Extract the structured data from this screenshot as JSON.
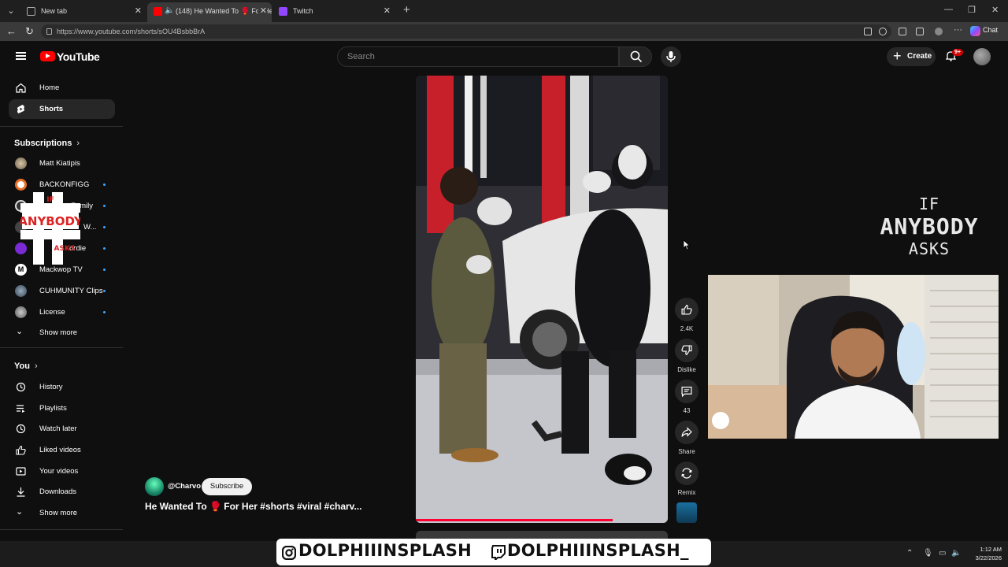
{
  "browser": {
    "tabs": [
      {
        "title": "New tab",
        "active": false
      },
      {
        "title": "(148) He Wanted To 🥊 For Her",
        "active": true
      },
      {
        "title": "Twitch",
        "active": false
      }
    ],
    "url": "https://www.youtube.com/shorts/sOU4BsbbBrA",
    "chat_label": "Chat"
  },
  "header": {
    "logo_text": "YouTube",
    "search_placeholder": "Search",
    "create_label": "Create",
    "notif_badge": "9+"
  },
  "sidebar": {
    "main": [
      {
        "label": "Home",
        "icon": "home-icon"
      },
      {
        "label": "Shorts",
        "icon": "shorts-icon",
        "active": true
      }
    ],
    "subscriptions_title": "Subscriptions",
    "subscriptions": [
      {
        "label": "Matt Kiatipis",
        "dot": false
      },
      {
        "label": "BACKONFIGG",
        "dot": true
      },
      {
        "label": "Family",
        "dot": true
      },
      {
        "label": "W...",
        "dot": true
      },
      {
        "label": "ordie",
        "dot": true
      },
      {
        "label": "Mackwop TV",
        "dot": true
      },
      {
        "label": "CUHMUNITY Clips",
        "dot": true
      },
      {
        "label": "License",
        "dot": true
      }
    ],
    "show_more_1": "Show more",
    "you_title": "You",
    "you_items": [
      {
        "label": "History",
        "icon": "history-icon"
      },
      {
        "label": "Playlists",
        "icon": "playlists-icon"
      },
      {
        "label": "Watch later",
        "icon": "watch-later-icon"
      },
      {
        "label": "Liked videos",
        "icon": "like-icon"
      },
      {
        "label": "Your videos",
        "icon": "video-icon"
      },
      {
        "label": "Downloads",
        "icon": "download-icon"
      }
    ],
    "show_more_2": "Show more"
  },
  "short": {
    "channel": "@Charvo",
    "subscribe_label": "Subscribe",
    "title": "He Wanted To 🥊 For Her #shorts #viral #charv...",
    "progress_fraction": 0.78,
    "actions": [
      {
        "icon": "thumbs-up-icon",
        "label": "2.4K"
      },
      {
        "icon": "thumbs-down-icon",
        "label": "Dislike"
      },
      {
        "icon": "comment-icon",
        "label": "43"
      },
      {
        "icon": "share-icon",
        "label": "Share"
      },
      {
        "icon": "remix-icon",
        "label": "Remix"
      }
    ]
  },
  "overlay": {
    "logo_lines": [
      "IF",
      "ANYBODY",
      "ASKS"
    ],
    "small_logo_lines": [
      "IF",
      "ANYBODY",
      "ASKS"
    ],
    "banner_handles": [
      "DOLPHIIINSPLASH",
      "DOLPHIIINSPLASH_"
    ]
  },
  "taskbar": {
    "time": "1:12 AM",
    "date": "3/22/2026"
  },
  "colors": {
    "brand_red": "#ff0000",
    "progress": "#ff0033",
    "dot_blue": "#3ea6ff",
    "bg": "#0f0f0f"
  }
}
